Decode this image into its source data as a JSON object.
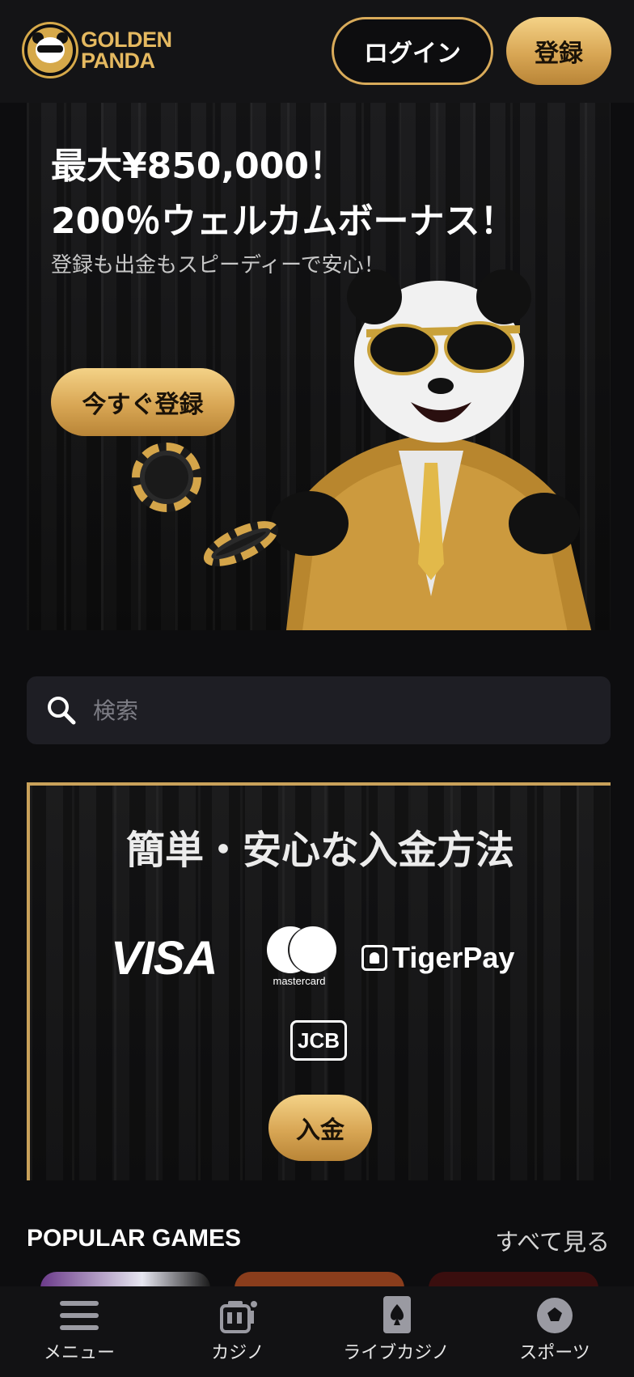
{
  "header": {
    "logo_line1": "GOLDEN",
    "logo_line2": "PANDA",
    "login_label": "ログイン",
    "register_label": "登録"
  },
  "hero": {
    "title_line1": "最大¥850,000！",
    "title_line2": "200％ウェルカムボーナス！",
    "subtitle": "登録も出金もスピーディーで安心！",
    "cta_label": "今すぐ登録"
  },
  "search": {
    "placeholder": "検索"
  },
  "payment": {
    "title": "簡単・安心な入金方法",
    "methods": [
      "VISA",
      "mastercard",
      "TigerPay",
      "JCB"
    ],
    "deposit_label": "入金"
  },
  "popular": {
    "title": "POPULAR GAMES",
    "see_all": "すべて見る"
  },
  "bottom_nav": [
    {
      "label": "メニュー",
      "icon": "menu-icon"
    },
    {
      "label": "カジノ",
      "icon": "slot-machine-icon"
    },
    {
      "label": "ライブカジノ",
      "icon": "spade-card-icon"
    },
    {
      "label": "スポーツ",
      "icon": "soccer-ball-icon"
    }
  ],
  "colors": {
    "accent_gold": "#d8a654",
    "background": "#0d0d0f",
    "header_bg": "#141416"
  }
}
